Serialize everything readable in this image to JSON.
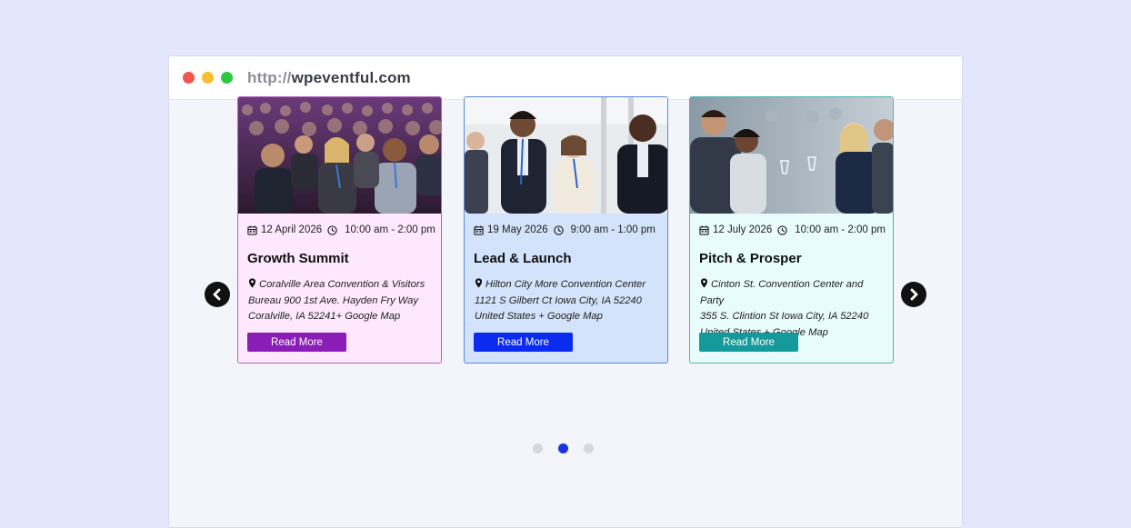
{
  "browser": {
    "url_protocol": "http://",
    "url_domain": "wpeventful.com"
  },
  "events": [
    {
      "date": "12 April 2026",
      "time": "10:00 am - 2:00 pm",
      "title": "Growth Summit",
      "address_lines": [
        "Coralville Area Convention & Visitors",
        "Bureau 900 1st Ave. Hayden Fry Way",
        "Coralville, IA 52241+ Google Map"
      ],
      "button_label": "Read More",
      "colors": {
        "background": "#fde8fd",
        "border": "#b362c4",
        "button": "#8a1db6"
      }
    },
    {
      "date": "19 May 2026",
      "time": "9:00 am - 1:00 pm",
      "title": "Lead & Launch",
      "address_lines": [
        "Hilton City More Convention Center",
        "1121 S Gilbert Ct Iowa City, IA 52240",
        "United States + Google Map"
      ],
      "button_label": "Read More",
      "colors": {
        "background": "#d2e3fb",
        "border": "#5f86d6",
        "button": "#0b2cf0"
      }
    },
    {
      "date": "12 July 2026",
      "time": "10:00 am - 2:00 pm",
      "title": "Pitch & Prosper",
      "address_lines": [
        "Cinton St. Convention Center and Party",
        "355 S. Clintion St Iowa City, IA 52240",
        "United States + Google Map"
      ],
      "button_label": "Read More",
      "colors": {
        "background": "#e8fcfb",
        "border": "#4cb6b0",
        "button": "#149a9a"
      }
    }
  ],
  "carousel": {
    "page_count": 3,
    "active_page": 2
  },
  "icons": {
    "calendar": "calendar-icon",
    "clock": "clock-icon",
    "pin": "map-pin-icon",
    "prev": "chevron-left-icon",
    "next": "chevron-right-icon"
  }
}
